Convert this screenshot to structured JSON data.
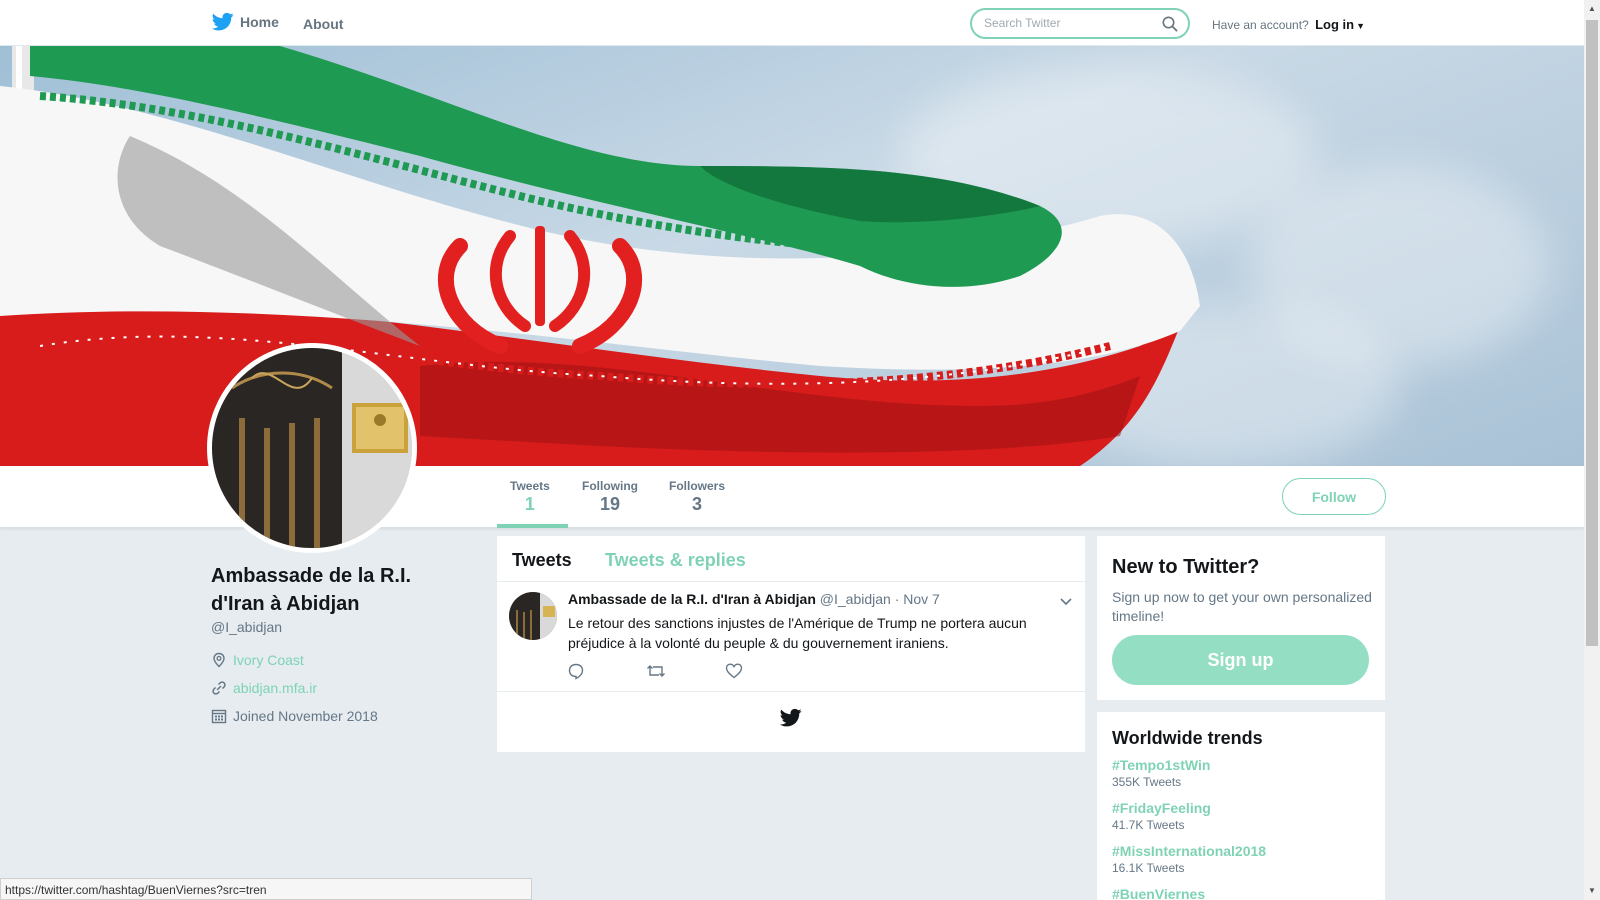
{
  "nav": {
    "home_label": "Home",
    "about_label": "About",
    "search_placeholder": "Search Twitter",
    "account_prompt": "Have an account?",
    "login_label": "Log in"
  },
  "profile": {
    "name": "Ambassade de la R.I. d'Iran à Abidjan",
    "handle": "@I_abidjan",
    "location": "Ivory Coast",
    "website": "abidjan.mfa.ir",
    "joined": "Joined November 2018"
  },
  "stats": [
    {
      "label": "Tweets",
      "value": "1"
    },
    {
      "label": "Following",
      "value": "19"
    },
    {
      "label": "Followers",
      "value": "3"
    }
  ],
  "follow_label": "Follow",
  "timeline": {
    "tabs": [
      "Tweets",
      "Tweets & replies"
    ],
    "tweets": [
      {
        "author": "Ambassade de la R.I. d'Iran à Abidjan",
        "handle": "@I_abidjan",
        "date": "· Nov 7",
        "text": "Le retour des sanctions injustes de l'Amérique de Trump ne portera aucun préjudice à la volonté du peuple & du gouvernement iraniens."
      }
    ]
  },
  "signup": {
    "title": "New to Twitter?",
    "text": "Sign up now to get your own personalized timeline!",
    "button": "Sign up"
  },
  "trends": {
    "title": "Worldwide trends",
    "items": [
      {
        "tag": "#Tempo1stWin",
        "count": "355K Tweets"
      },
      {
        "tag": "#FridayFeeling",
        "count": "41.7K Tweets"
      },
      {
        "tag": "#MissInternational2018",
        "count": "16.1K Tweets"
      },
      {
        "tag": "#BuenViernes",
        "count": ""
      }
    ]
  },
  "status_url": "https://twitter.com/hashtag/BuenViernes?src=tren",
  "colors": {
    "accent": "#7fd3b4",
    "background": "#e6ecf0",
    "flag_green": "#1f9a52",
    "flag_red": "#d81c1c"
  }
}
